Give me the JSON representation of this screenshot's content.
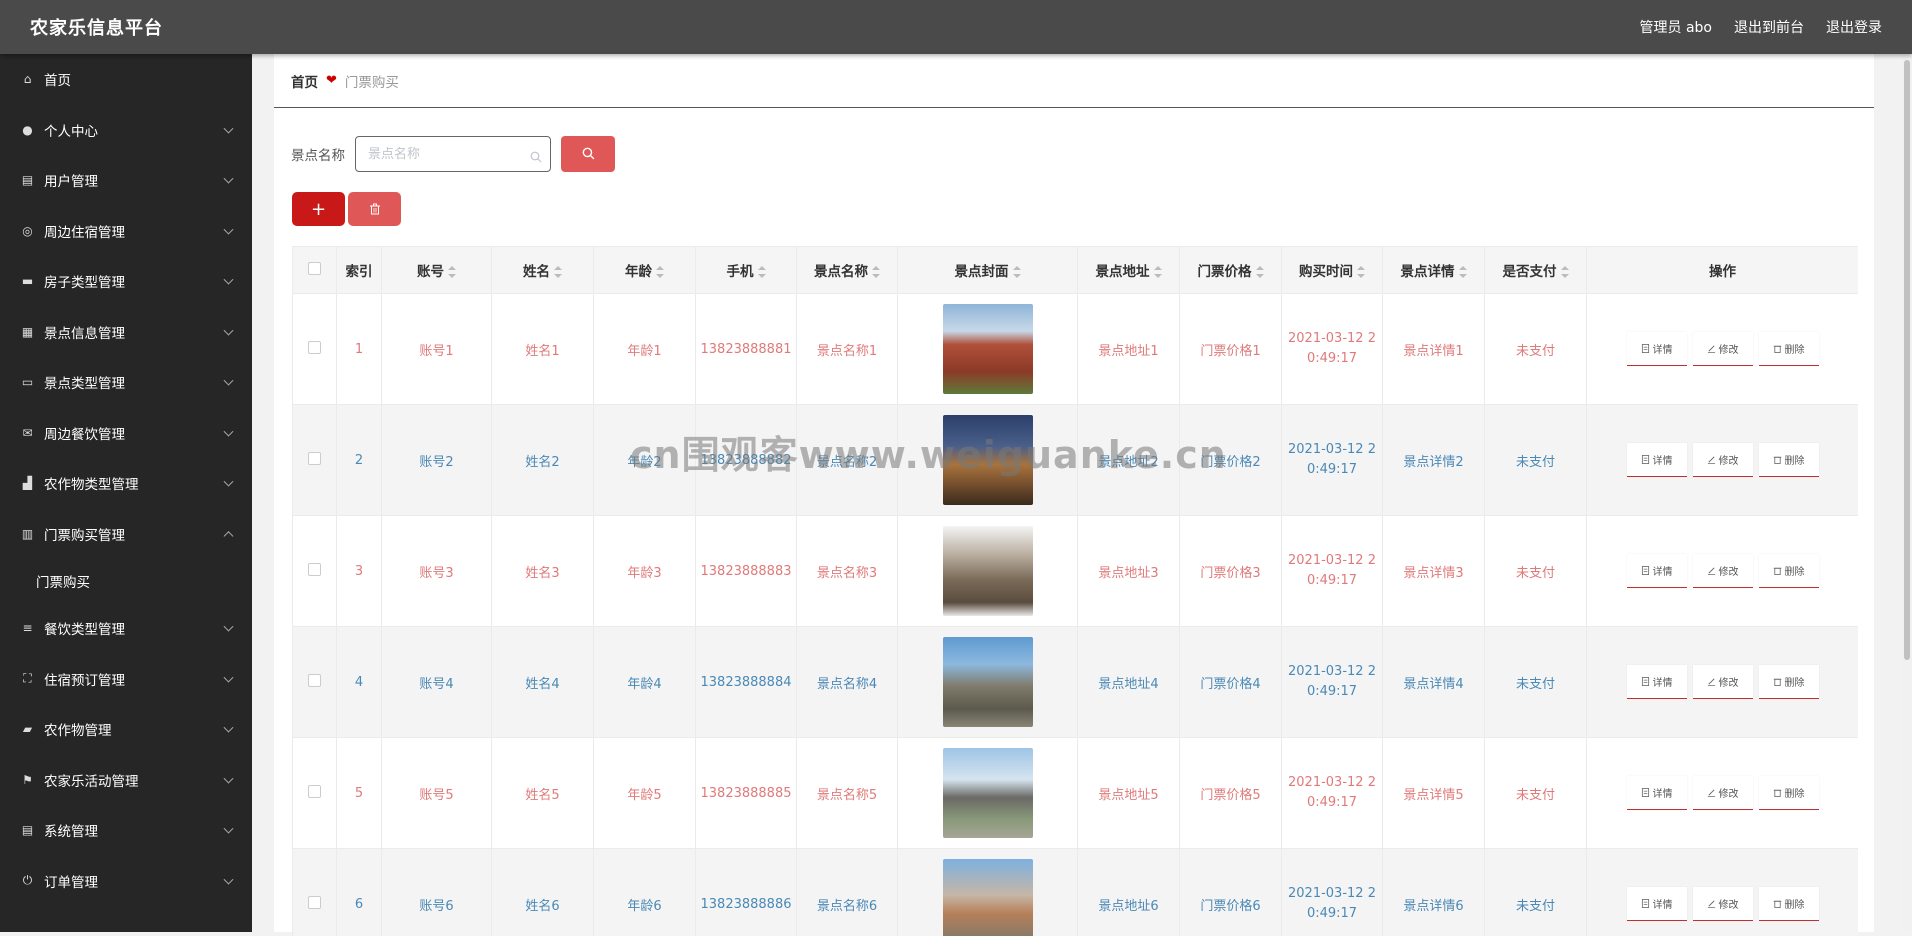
{
  "header": {
    "brand": "农家乐信息平台",
    "user": "管理员 abo",
    "to_front": "退出到前台",
    "logout": "退出登录"
  },
  "sidebar": {
    "items": [
      {
        "label": "首页",
        "icon": "home-icon",
        "arrow": false
      },
      {
        "label": "个人中心",
        "icon": "user-icon",
        "arrow": true
      },
      {
        "label": "用户管理",
        "icon": "clipboard-icon",
        "arrow": true
      },
      {
        "label": "周边住宿管理",
        "icon": "compass-icon",
        "arrow": true
      },
      {
        "label": "房子类型管理",
        "icon": "chat-icon",
        "arrow": true
      },
      {
        "label": "景点信息管理",
        "icon": "grid-icon",
        "arrow": true
      },
      {
        "label": "景点类型管理",
        "icon": "card-icon",
        "arrow": true
      },
      {
        "label": "周边餐饮管理",
        "icon": "mail-icon",
        "arrow": true
      },
      {
        "label": "农作物类型管理",
        "icon": "thumb-icon",
        "arrow": true
      },
      {
        "label": "门票购买管理",
        "icon": "chart-icon",
        "arrow": true,
        "open": true
      },
      {
        "label": "餐饮类型管理",
        "icon": "list-icon",
        "arrow": true
      },
      {
        "label": "住宿预订管理",
        "icon": "fullscreen-icon",
        "arrow": true
      },
      {
        "label": "农作物管理",
        "icon": "book-icon",
        "arrow": true
      },
      {
        "label": "农家乐活动管理",
        "icon": "flag-icon",
        "arrow": true
      },
      {
        "label": "系统管理",
        "icon": "clipboard-icon",
        "arrow": true
      },
      {
        "label": "订单管理",
        "icon": "power-icon",
        "arrow": true
      }
    ],
    "submenu_label": "门票购买"
  },
  "breadcrumb": {
    "home": "首页",
    "current": "门票购买"
  },
  "search": {
    "label": "景点名称",
    "placeholder": "景点名称"
  },
  "colors": {
    "accent": "#e05757",
    "add_button": "#c81818",
    "odd_row_text": "#e07a7a",
    "even_row_text": "#4a89b6"
  },
  "table": {
    "headers": [
      "索引",
      "账号",
      "姓名",
      "年龄",
      "手机",
      "景点名称",
      "景点封面",
      "景点地址",
      "门票价格",
      "购买时间",
      "景点详情",
      "是否支付",
      "操作"
    ],
    "ops": {
      "detail": "详情",
      "edit": "修改",
      "delete": "删除"
    },
    "rows": [
      {
        "index": "1",
        "account": "账号1",
        "name": "姓名1",
        "age": "年龄1",
        "phone": "13823888881",
        "spot": "景点名称1",
        "address": "景点地址1",
        "price": "门票价格1",
        "time_a": "2021-03-12 2",
        "time_b": "0:49:17",
        "detail": "景点详情1",
        "paid": "未支付"
      },
      {
        "index": "2",
        "account": "账号2",
        "name": "姓名2",
        "age": "年龄2",
        "phone": "13823888882",
        "spot": "景点名称2",
        "address": "景点地址2",
        "price": "门票价格2",
        "time_a": "2021-03-12 2",
        "time_b": "0:49:17",
        "detail": "景点详情2",
        "paid": "未支付"
      },
      {
        "index": "3",
        "account": "账号3",
        "name": "姓名3",
        "age": "年龄3",
        "phone": "13823888883",
        "spot": "景点名称3",
        "address": "景点地址3",
        "price": "门票价格3",
        "time_a": "2021-03-12 2",
        "time_b": "0:49:17",
        "detail": "景点详情3",
        "paid": "未支付"
      },
      {
        "index": "4",
        "account": "账号4",
        "name": "姓名4",
        "age": "年龄4",
        "phone": "13823888884",
        "spot": "景点名称4",
        "address": "景点地址4",
        "price": "门票价格4",
        "time_a": "2021-03-12 2",
        "time_b": "0:49:17",
        "detail": "景点详情4",
        "paid": "未支付"
      },
      {
        "index": "5",
        "account": "账号5",
        "name": "姓名5",
        "age": "年龄5",
        "phone": "13823888885",
        "spot": "景点名称5",
        "address": "景点地址5",
        "price": "门票价格5",
        "time_a": "2021-03-12 2",
        "time_b": "0:49:17",
        "detail": "景点详情5",
        "paid": "未支付"
      },
      {
        "index": "6",
        "account": "账号6",
        "name": "姓名6",
        "age": "年龄6",
        "phone": "13823888886",
        "spot": "景点名称6",
        "address": "景点地址6",
        "price": "门票价格6",
        "time_a": "2021-03-12 2",
        "time_b": "0:49:17",
        "detail": "景点详情6",
        "paid": "未支付"
      }
    ]
  },
  "watermark": "cn围观客www.weiguanke.cn"
}
